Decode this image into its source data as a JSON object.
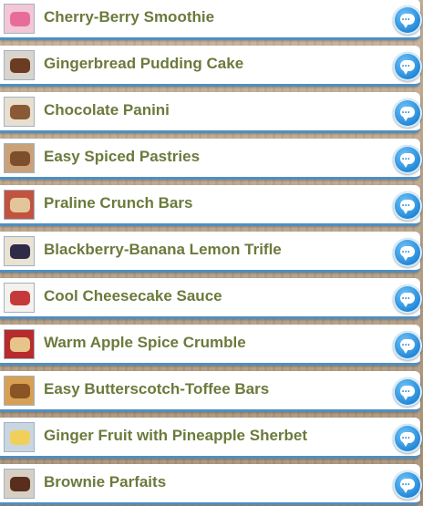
{
  "recipes": [
    {
      "title": "Cherry-Berry Smoothie",
      "thumb_colors": [
        "#f3c7d6",
        "#e86c9a"
      ],
      "icon": "chat-bubble-icon"
    },
    {
      "title": "Gingerbread Pudding Cake",
      "thumb_colors": [
        "#d9d4cc",
        "#6b3b22"
      ],
      "icon": "chat-bubble-icon"
    },
    {
      "title": "Chocolate Panini",
      "thumb_colors": [
        "#e9dfcf",
        "#8a5a36"
      ],
      "icon": "chat-bubble-icon"
    },
    {
      "title": "Easy Spiced Pastries",
      "thumb_colors": [
        "#c9a27a",
        "#7d4e2b"
      ],
      "icon": "chat-bubble-icon"
    },
    {
      "title": "Praline Crunch Bars",
      "thumb_colors": [
        "#c2533e",
        "#e3c59b"
      ],
      "icon": "chat-bubble-icon"
    },
    {
      "title": "Blackberry-Banana Lemon Trifle",
      "thumb_colors": [
        "#eae3d1",
        "#2e2a48"
      ],
      "icon": "chat-bubble-icon"
    },
    {
      "title": "Cool Cheesecake Sauce",
      "thumb_colors": [
        "#f4f1ee",
        "#c43a3a"
      ],
      "icon": "chat-bubble-icon"
    },
    {
      "title": "Warm Apple Spice Crumble",
      "thumb_colors": [
        "#b72b2b",
        "#e6c48a"
      ],
      "icon": "chat-bubble-icon"
    },
    {
      "title": "Easy Butterscotch-Toffee Bars",
      "thumb_colors": [
        "#d8a055",
        "#8a5424"
      ],
      "icon": "chat-bubble-icon"
    },
    {
      "title": "Ginger Fruit with Pineapple Sherbet",
      "thumb_colors": [
        "#c9d6e0",
        "#f0d05a"
      ],
      "icon": "chat-bubble-icon"
    },
    {
      "title": "Brownie Parfaits",
      "thumb_colors": [
        "#d8cfc4",
        "#5a2e1c"
      ],
      "icon": "chat-bubble-icon"
    }
  ],
  "colors": {
    "title_text": "#6b7a3c",
    "row_border": "#4f8fc2",
    "chat_button": "#1d83d6"
  }
}
